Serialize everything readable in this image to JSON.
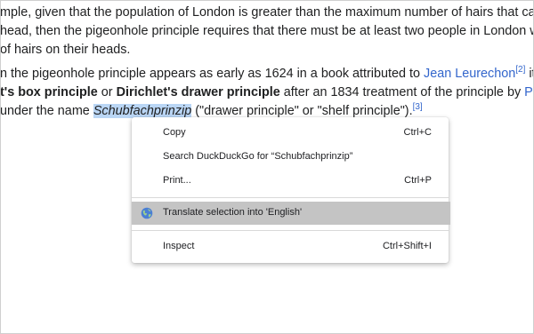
{
  "article": {
    "line1": "mple, given that the population of London is greater than the maximum number of hairs that can be pre",
    "line2": " head, then the pigeonhole principle requires that there must be at least two people in London who ha",
    "line3": "of hairs on their heads.",
    "line4_pre": "n the pigeonhole principle appears as early as 1624 in a book attributed to ",
    "line4_link": "Jean Leurechon",
    "line4_cite": "[2]",
    "line4_post": " it is com",
    "line5_bold1": "t's box principle",
    "line5_mid": " or ",
    "line5_bold2": "Dirichlet's drawer principle",
    "line5_post": " after an 1834 treatment of the principle by ",
    "line5_link": "Peter Gus",
    "line6_pre": "under the name ",
    "line6_selected": "Schubfachprinzip",
    "line6_post": " (\"drawer principle\" or \"shelf principle\").",
    "line6_cite": "[3]"
  },
  "context_menu": {
    "items": [
      {
        "label": "Copy",
        "shortcut": "Ctrl+C"
      },
      {
        "label": "Search DuckDuckGo for “Schubfachprinzip”",
        "shortcut": ""
      },
      {
        "label": "Print...",
        "shortcut": "Ctrl+P"
      },
      {
        "label": "Translate selection into 'English'",
        "shortcut": "",
        "icon": "globe-icon",
        "highlighted": true
      },
      {
        "label": "Inspect",
        "shortcut": "Ctrl+Shift+I"
      }
    ]
  },
  "colors": {
    "link": "#3366cc",
    "selection": "#bad6f5",
    "menu_highlight": "#c4c4c4"
  }
}
